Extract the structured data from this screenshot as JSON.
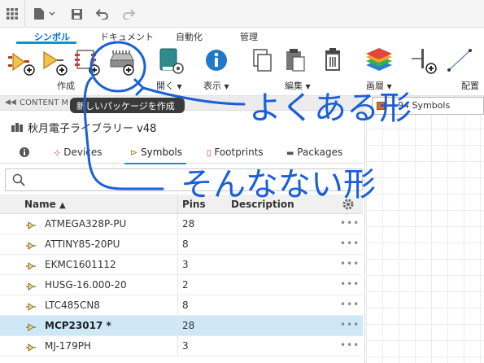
{
  "ribbon_tabs": [
    "シンボル",
    "ドキュメント",
    "自動化",
    "管理"
  ],
  "ribbon_groups": {
    "create": "作成",
    "open": "開く",
    "display": "表示",
    "edit": "編集",
    "layer": "画層",
    "placement": "配置"
  },
  "tooltip": "新しいパッケージを作成",
  "panel": {
    "header": "CONTENT M",
    "library_title": "秋月電子ライブラリー v48",
    "tabs": [
      "Devices",
      "Symbols",
      "Footprints",
      "Packages"
    ],
    "search_placeholder": "",
    "columns": {
      "name": "Name",
      "pins": "Pins",
      "description": "Description"
    },
    "rows": [
      {
        "name": "ATMEGA328P-PU",
        "pins": "28"
      },
      {
        "name": "ATTINY85-20PU",
        "pins": "8"
      },
      {
        "name": "EKMC1601112",
        "pins": "3"
      },
      {
        "name": "HUSG-16.000-20",
        "pins": "2"
      },
      {
        "name": "LTC485CN8",
        "pins": "8"
      },
      {
        "name": "MCP23017 *",
        "pins": "28",
        "selected": true
      },
      {
        "name": "MJ-179PH",
        "pins": "3"
      }
    ]
  },
  "layer_dropdown": "94 Symbols",
  "annotations": {
    "common_shape": "よくある形",
    "unusual_shape": "そんなない形"
  },
  "colors": {
    "accent": "#0696d7",
    "selected_row": "#cfe8f7",
    "ink": "#1a5fd8"
  }
}
